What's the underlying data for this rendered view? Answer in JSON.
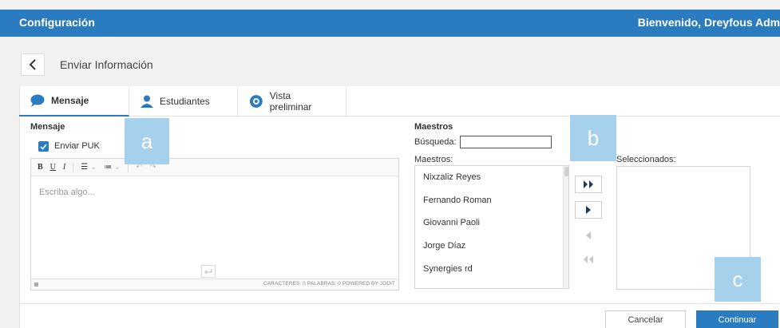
{
  "topbar": {
    "title": "Configuración",
    "welcome": "Bienvenido, Dreyfous Admi"
  },
  "page": {
    "title": "Enviar Información"
  },
  "tabs": [
    {
      "label": "Mensaje",
      "icon": "chat-bubble-icon"
    },
    {
      "label": "Estudiantes",
      "icon": "person-icon"
    },
    {
      "label": "Vista preliminar",
      "icon": "eye-icon"
    }
  ],
  "mensaje": {
    "heading": "Mensaje",
    "enviar_puk": "Enviar PUK",
    "placeholder": "Escriba algo...",
    "counter": "CARACTERES: 0   PALABRAS: 0   POWERED BY JODIT",
    "toolbar": {
      "bold": "B",
      "underline": "U",
      "italic": "I",
      "ul": "☰",
      "ol": "≔",
      "undo": "↶",
      "redo": "↷"
    }
  },
  "maestros": {
    "heading": "Maestros",
    "search_label": "Búsqueda:",
    "list_label": "Maestros:",
    "selected_label": "Seleccionados:",
    "items": [
      "Nixzaliz Reyes",
      "Fernando Roman",
      "Giovanni Paoli",
      "Jorge Díaz",
      "Synergies rd"
    ]
  },
  "buttons": {
    "cancel": "Cancelar",
    "continue": "Continuar"
  },
  "markers": {
    "a": "a",
    "b": "b",
    "c": "c"
  },
  "colors": {
    "primary": "#2b7bc0",
    "marker": "#a6d1ec"
  }
}
